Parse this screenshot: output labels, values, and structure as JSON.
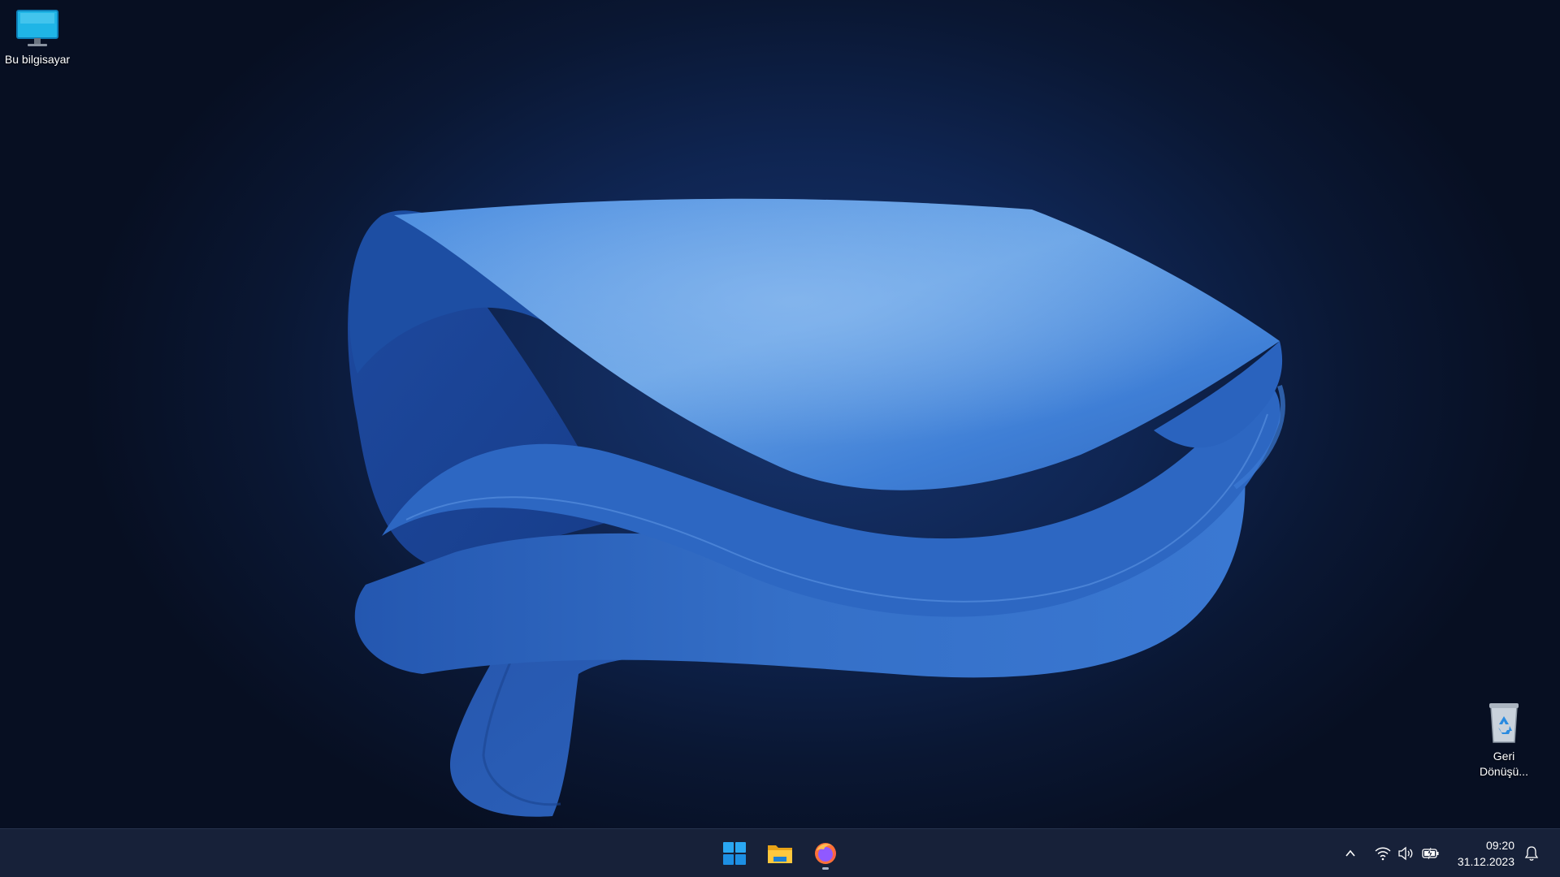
{
  "desktop": {
    "icons": [
      {
        "label": "Bu bilgisayar",
        "icon": "monitor-icon"
      },
      {
        "label": "Geri Dönüşü...",
        "icon": "recycle-bin-icon"
      }
    ],
    "wallpaper": "windows-11-bloom-dark"
  },
  "taskbar": {
    "apps": [
      {
        "name": "Başlat",
        "icon": "windows-start-icon"
      },
      {
        "name": "Dosya Gezgini",
        "icon": "folder-icon"
      },
      {
        "name": "Firefox",
        "icon": "firefox-icon",
        "running": true
      }
    ],
    "tray": {
      "icons": [
        "chevron-up-icon",
        "wifi-icon",
        "volume-icon",
        "battery-charging-icon",
        "notification-bell-icon"
      ],
      "time": "09:20",
      "date": "31.12.2023"
    }
  },
  "colors": {
    "taskbar_bg": "#172139",
    "wallpaper_bg": "#0a1733",
    "bloom_blue": "#3a78d4",
    "windows_blue": "#1f9cf0"
  }
}
